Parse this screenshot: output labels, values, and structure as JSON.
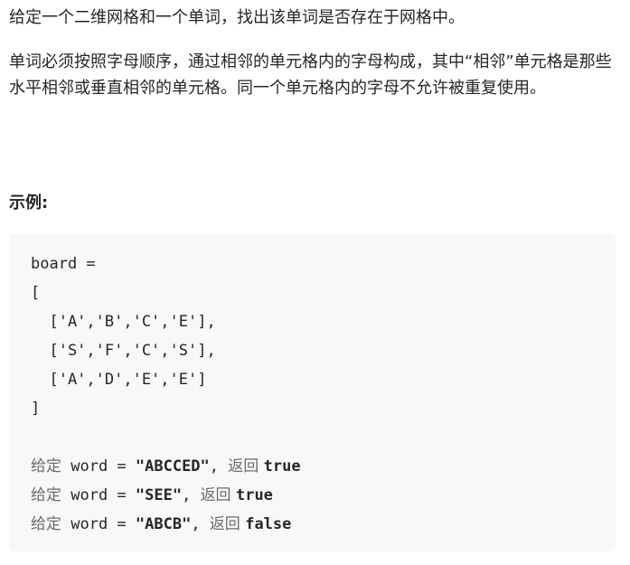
{
  "problem": {
    "para1": "给定一个二维网格和一个单词，找出该单词是否存在于网格中。",
    "para2": "单词必须按照字母顺序，通过相邻的单元格内的字母构成，其中“相邻”单元格是那些水平相邻或垂直相邻的单元格。同一个单元格内的字母不允许被重复使用。",
    "example_heading": "示例:"
  },
  "code": {
    "line1": "board =",
    "line2": "[",
    "row1": "  ['A','B','C','E'],",
    "row2": "  ['S','F','C','S'],",
    "row3": "  ['A','D','E','E']",
    "line_close": "]",
    "examples": [
      {
        "given": "给定",
        "word_kw": " word = ",
        "value": "\"ABCCED\"",
        "sep": ", ",
        "ret": "返回 ",
        "result": "true"
      },
      {
        "given": "给定",
        "word_kw": " word = ",
        "value": "\"SEE\"",
        "sep": ", ",
        "ret": "返回 ",
        "result": "true"
      },
      {
        "given": "给定",
        "word_kw": " word = ",
        "value": "\"ABCB\"",
        "sep": ", ",
        "ret": "返回 ",
        "result": "false"
      }
    ]
  }
}
